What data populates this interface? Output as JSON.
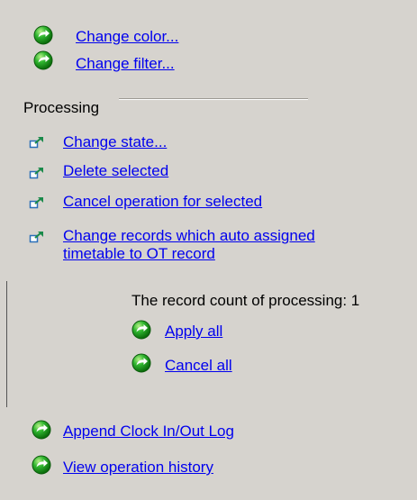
{
  "top_links": {
    "change_color": "Change color...",
    "change_filter": "Change filter..."
  },
  "processing": {
    "title": "Processing",
    "change_state": "Change state...",
    "delete_selected": "Delete selected",
    "cancel_operation": "Cancel operation for selected",
    "change_records_line1": "Change records which auto assigned",
    "change_records_line2": "timetable to OT record"
  },
  "record_count": {
    "label": "The record count of processing: 1",
    "apply_all": "Apply all",
    "cancel_all": "Cancel all"
  },
  "bottom_links": {
    "append_log": "Append Clock In/Out Log",
    "view_history": "View operation history"
  },
  "icons": {
    "go": "green-circle-arrow-icon",
    "jump": "blue-arrow-link-icon"
  },
  "colors": {
    "background": "#d6d3ce",
    "link": "#0000ee",
    "go_green": "#1a9a1a"
  }
}
